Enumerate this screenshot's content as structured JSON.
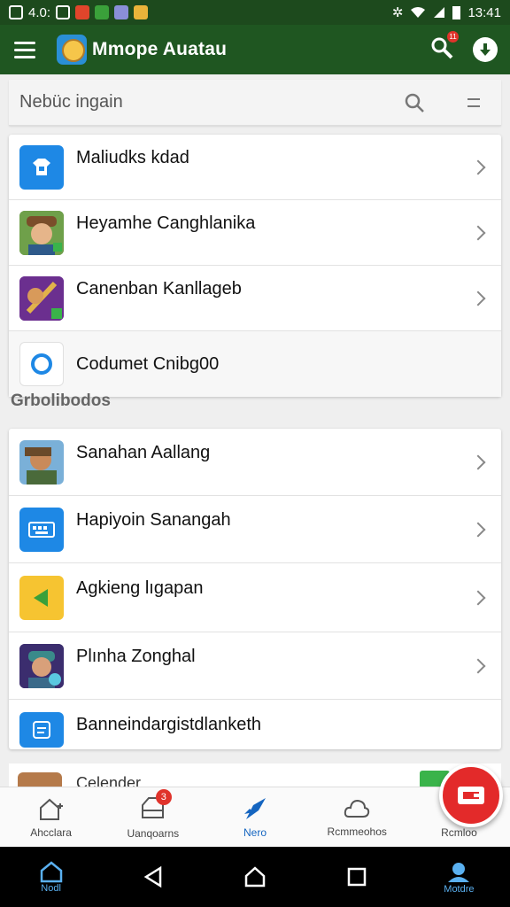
{
  "status_bar": {
    "left_text": "4.0:",
    "time": "13:41"
  },
  "app_bar": {
    "title": "Mmope Auatau",
    "notification_count": "11"
  },
  "search": {
    "placeholder": "Nebüc ingain"
  },
  "top_list": [
    {
      "label": "Maliudks kdad",
      "icon": "shirt-icon",
      "color": "#1e88e5",
      "chevron": true
    },
    {
      "label": "Heyamhe Canghlanika",
      "icon": "character-avatar-icon",
      "color": "#4b7d2f",
      "chevron": true
    },
    {
      "label": "Canenban Kanllageb",
      "icon": "hero-sword-icon",
      "color": "#7a3aa0",
      "chevron": true
    },
    {
      "label": "Codumet Cnibg00",
      "icon": "circle-icon",
      "color": "#1e88e5",
      "chevron": false
    }
  ],
  "section_title": "Grbolibodos",
  "bottom_list": [
    {
      "label": "Sanahan Aallang",
      "icon": "warrior-avatar-icon",
      "color": "#5a7c9e",
      "chevron": true
    },
    {
      "label": "Hapiyoin Sanangah",
      "icon": "keyboard-icon",
      "color": "#1e88e5",
      "chevron": true
    },
    {
      "label": "Agkieng lıgapan",
      "icon": "play-triangle-icon",
      "color": "#f6c431",
      "chevron": true
    },
    {
      "label": "Plınha Zonghal",
      "icon": "soldier-avatar-icon",
      "color": "#3b2d6e",
      "chevron": true
    },
    {
      "label": "Banneindargistdlanketh",
      "icon": "document-icon",
      "color": "#1e88e5",
      "chevron": false
    }
  ],
  "peek_label": "Celender",
  "bottom_nav": [
    {
      "label": "Ahcclara",
      "icon": "home-icon",
      "active": false
    },
    {
      "label": "Uanqoarns",
      "icon": "inbox-icon",
      "badge": "3",
      "active": false
    },
    {
      "label": "Nero",
      "icon": "rocket-icon",
      "active": true
    },
    {
      "label": "Rcmmeohos",
      "icon": "cloud-icon",
      "active": false
    },
    {
      "label": "Rcmloo",
      "icon": "menu-icon",
      "active": false
    }
  ],
  "system_nav": {
    "home_label": "Nodl",
    "assistant_label": "Motdre"
  },
  "colors": {
    "appbar": "#1f5621",
    "status": "#1d4a1d",
    "accent": "#1565c0",
    "fab": "#e32a2a"
  }
}
